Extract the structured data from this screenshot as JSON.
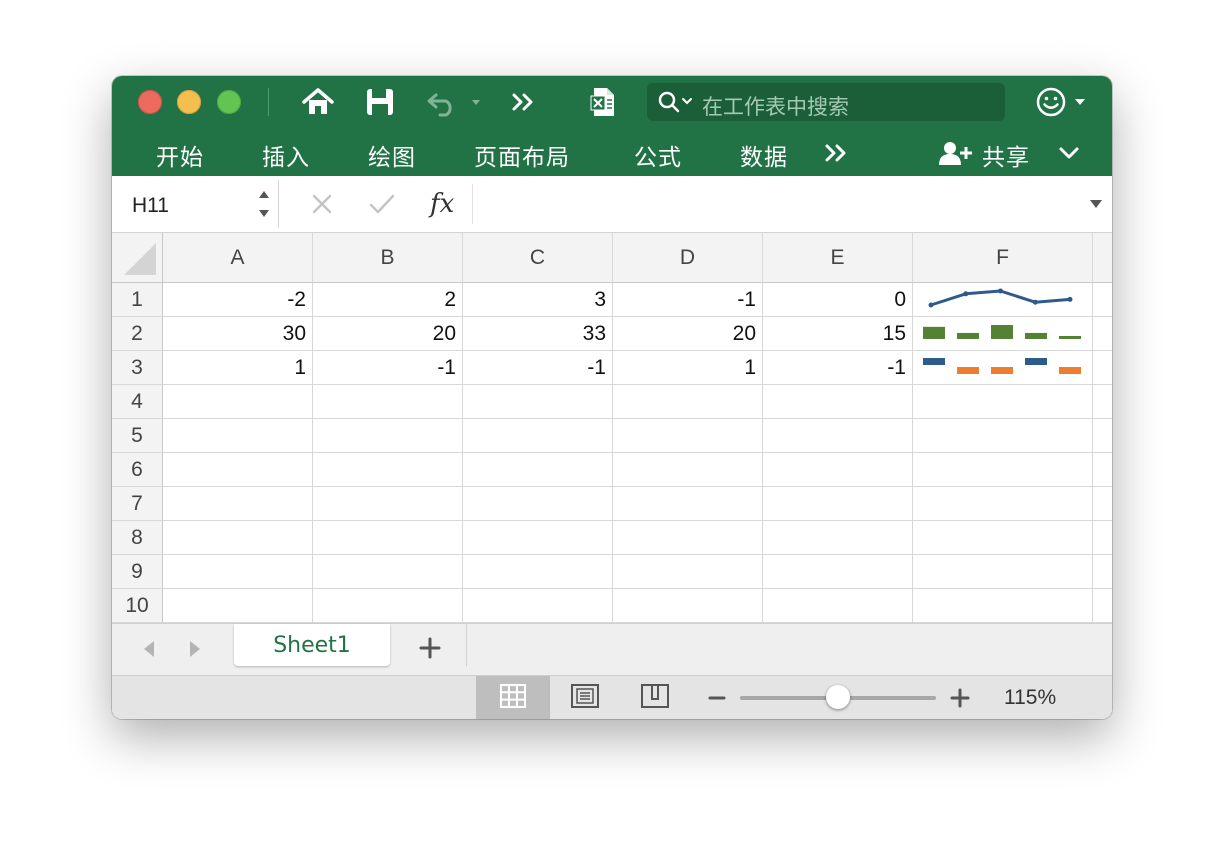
{
  "toolbar": {
    "search_placeholder": "在工作表中搜索"
  },
  "ribbon": {
    "tabs": [
      "开始",
      "插入",
      "绘图",
      "页面布局",
      "公式",
      "数据"
    ],
    "share_label": "共享"
  },
  "formula_bar": {
    "name_box": "H11",
    "formula": ""
  },
  "grid": {
    "columns": [
      "A",
      "B",
      "C",
      "D",
      "E",
      "F"
    ],
    "rows": [
      "1",
      "2",
      "3",
      "4",
      "5",
      "6",
      "7",
      "8",
      "9",
      "10"
    ],
    "cells": [
      [
        "-2",
        "2",
        "3",
        "-1",
        "0"
      ],
      [
        "30",
        "20",
        "33",
        "20",
        "15"
      ],
      [
        "1",
        "-1",
        "-1",
        "1",
        "-1"
      ]
    ]
  },
  "sparklines": {
    "line": {
      "values": [
        -2,
        2,
        3,
        -1,
        0
      ],
      "color": "#2f5b8a"
    },
    "column": {
      "values": [
        30,
        20,
        33,
        20,
        15
      ],
      "color": "#548235"
    },
    "win_loss": {
      "values": [
        1,
        -1,
        -1,
        1,
        -1
      ],
      "positive_color": "#2f5b8a",
      "negative_color": "#ed7d31"
    }
  },
  "sheets": {
    "tabs": [
      "Sheet1"
    ]
  },
  "status": {
    "zoom": "115%",
    "zoom_fraction": 0.5
  },
  "colors": {
    "accent": "#217346",
    "search_bg": "#1b5f39"
  }
}
